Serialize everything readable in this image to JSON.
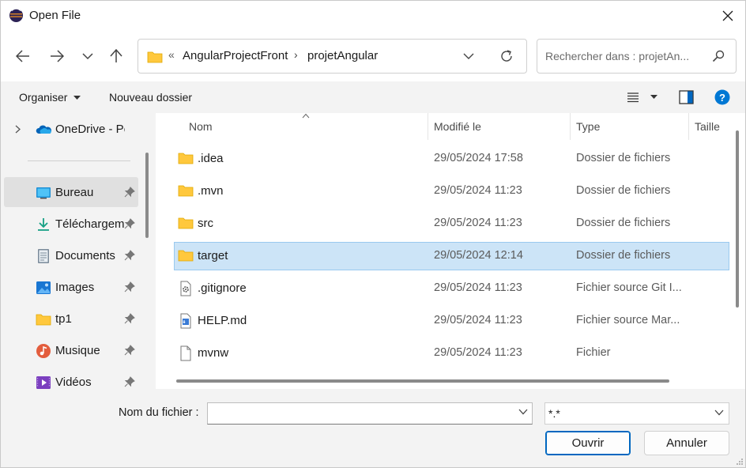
{
  "window": {
    "title": "Open File",
    "app_icon": "eclipse-icon"
  },
  "nav": {
    "back_icon": "arrow-left-icon",
    "forward_icon": "arrow-right-icon",
    "recent_icon": "chevron-down-icon",
    "up_icon": "arrow-up-icon",
    "breadcrumb_overflow": "«",
    "breadcrumbs": [
      "AngularProjectFront",
      "projetAngular"
    ],
    "breadcrumb_separator": "›",
    "search_placeholder": "Rechercher dans : projetAn..."
  },
  "commandbar": {
    "organize_label": "Organiser",
    "new_folder_label": "Nouveau dossier",
    "view_icon": "list-view-icon",
    "preview_pane_icon": "preview-pane-icon",
    "help_icon": "help-icon"
  },
  "sidebar": {
    "items": [
      {
        "label": "OneDrive - Perso",
        "icon": "onedrive-icon",
        "pinned": false,
        "expandable": true
      },
      {
        "label": "Bureau",
        "icon": "desktop-icon",
        "pinned": true,
        "selected": true
      },
      {
        "label": "Téléchargements",
        "icon": "download-icon",
        "pinned": true
      },
      {
        "label": "Documents",
        "icon": "documents-icon",
        "pinned": true
      },
      {
        "label": "Images",
        "icon": "images-icon",
        "pinned": true
      },
      {
        "label": "tp1",
        "icon": "folder-icon",
        "pinned": true
      },
      {
        "label": "Musique",
        "icon": "music-icon",
        "pinned": true
      },
      {
        "label": "Vidéos",
        "icon": "videos-icon",
        "pinned": true
      }
    ]
  },
  "files": {
    "columns": [
      "Nom",
      "Modifié le",
      "Type",
      "Taille"
    ],
    "rows": [
      {
        "name": ".idea",
        "modified": "29/05/2024 17:58",
        "type": "Dossier de fichiers",
        "icon": "folder-icon"
      },
      {
        "name": ".mvn",
        "modified": "29/05/2024 11:23",
        "type": "Dossier de fichiers",
        "icon": "folder-icon"
      },
      {
        "name": "src",
        "modified": "29/05/2024 11:23",
        "type": "Dossier de fichiers",
        "icon": "folder-icon"
      },
      {
        "name": "target",
        "modified": "29/05/2024 12:14",
        "type": "Dossier de fichiers",
        "icon": "folder-icon",
        "selected": true
      },
      {
        "name": ".gitignore",
        "modified": "29/05/2024 11:23",
        "type": "Fichier source Git I...",
        "icon": "gear-file-icon"
      },
      {
        "name": "HELP.md",
        "modified": "29/05/2024 11:23",
        "type": "Fichier source Mar...",
        "icon": "markdown-file-icon"
      },
      {
        "name": "mvnw",
        "modified": "29/05/2024 11:23",
        "type": "Fichier",
        "icon": "file-icon"
      }
    ]
  },
  "footer": {
    "filename_label": "Nom du fichier :",
    "filename_value": "",
    "filter_value": "*.*",
    "open_label": "Ouvrir",
    "cancel_label": "Annuler"
  },
  "colors": {
    "accent": "#0067c0",
    "selection": "#cce4f7",
    "folder": "#ffc83d"
  }
}
